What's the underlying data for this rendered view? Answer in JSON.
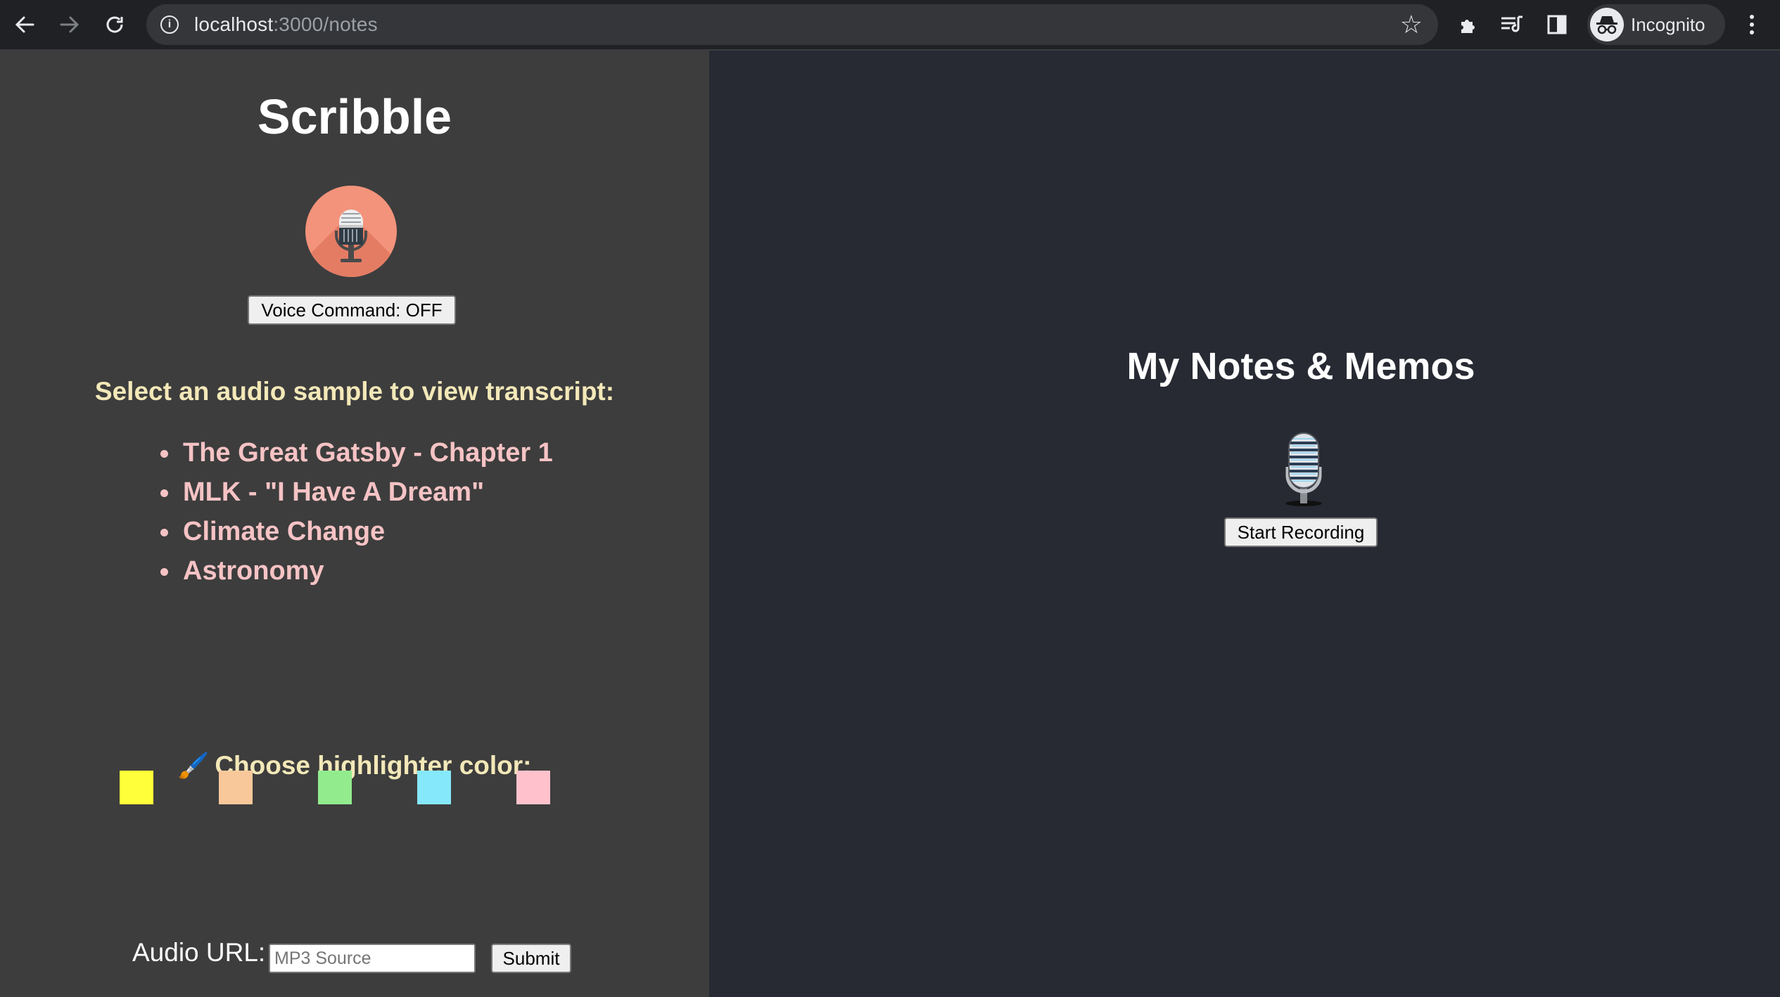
{
  "browser": {
    "url_host": "localhost",
    "url_path": ":3000/notes",
    "profile_label": "Incognito",
    "icons": [
      "back-arrow-icon",
      "forward-arrow-icon",
      "reload-icon",
      "info-icon",
      "star-icon",
      "extensions-icon",
      "media-queue-icon",
      "side-panel-icon",
      "incognito-icon",
      "more-menu-icon"
    ]
  },
  "left": {
    "title": "Scribble",
    "voice_button": "Voice Command: OFF",
    "select_heading": "Select an audio sample to view transcript:",
    "samples": [
      "The Great Gatsby - Chapter 1",
      "MLK - \"I Have A Dream\"",
      "Climate Change",
      "Astronomy"
    ],
    "highlighter_heading": "Choose highlighter color:",
    "highlighter_icon": "🖌️",
    "swatches": [
      "#ffff3a",
      "#f8c89a",
      "#92ec8e",
      "#86e8fb",
      "#ffc2cc"
    ],
    "audio_url_label": "Audio URL:",
    "audio_url_placeholder": "MP3 Source",
    "audio_url_value": "",
    "submit_button": "Submit"
  },
  "right": {
    "title": "My Notes & Memos",
    "record_button": "Start Recording"
  },
  "colors": {
    "left_panel_bg": "#3d3d3d",
    "right_panel_bg": "#272a33",
    "heading_yellow": "#f3e8b8",
    "link_pink": "#f6c3c5",
    "mic_circle": "#f3937b"
  }
}
